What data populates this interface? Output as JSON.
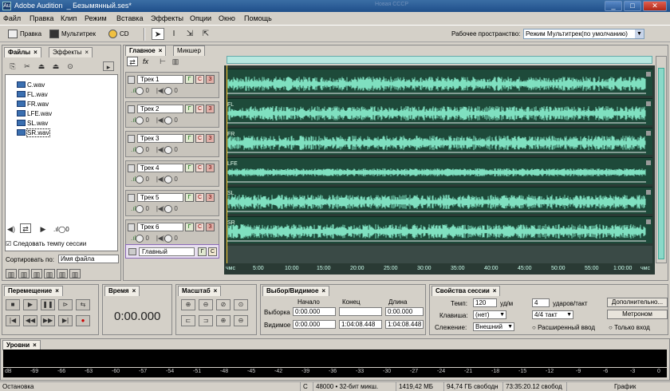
{
  "window": {
    "app_name": "Adobe Audition",
    "document_title": "Безымянный.ses*",
    "background_title": "Новая СССР",
    "minimize": "_",
    "maximize": "□",
    "close": "✕"
  },
  "menu": [
    "Файл",
    "Правка",
    "Клип",
    "Режим",
    "Вставка",
    "Эффекты",
    "Опции",
    "Окно",
    "Помощь"
  ],
  "toolbar": {
    "edit_label": "Правка",
    "multitrack_label": "Мультитрек",
    "cd_label": "CD",
    "workspace_label": "Рабочее пространство:",
    "workspace_value": "Режим Мультитрек(по умолчанию)"
  },
  "files_panel": {
    "tabs": [
      "Файлы",
      "Эффекты"
    ],
    "files": [
      "C.wav",
      "FL.wav",
      "FR.wav",
      "LFE.wav",
      "SL.wav",
      "SR.wav"
    ],
    "selected_file": "SR.wav",
    "follow_tempo_label": "Следовать темпу сессии",
    "follow_tempo_checked": true,
    "sort_label": "Сортировать по:",
    "sort_value": "Имя файла",
    "volume_value": "0"
  },
  "main_panel": {
    "tabs": [
      "Главное",
      "Микшер"
    ],
    "fx_label": "fx"
  },
  "tracks": [
    {
      "name": "Трек 1",
      "clip_label": "",
      "volume": "0",
      "pan": "0"
    },
    {
      "name": "Трек 2",
      "clip_label": "FL",
      "volume": "0",
      "pan": "0"
    },
    {
      "name": "Трек 3",
      "clip_label": "FR",
      "volume": "0",
      "pan": "0"
    },
    {
      "name": "Трек 4",
      "clip_label": "LFE",
      "volume": "0",
      "pan": "0"
    },
    {
      "name": "Трек 5",
      "clip_label": "SL",
      "volume": "0",
      "pan": "0"
    },
    {
      "name": "Трек 6",
      "clip_label": "SR",
      "volume": "0",
      "pan": "0"
    }
  ],
  "track_buttons": {
    "mute": "Г",
    "solo": "С",
    "record": "З"
  },
  "master": {
    "name": "Главный",
    "btn1": "Г",
    "btn2": "С"
  },
  "ruler": {
    "labels": [
      "чмс",
      "5:00",
      "10:00",
      "15:00",
      "20:00",
      "25:00",
      "30:00",
      "35:00",
      "40:00",
      "45:00",
      "50:00",
      "55:00",
      "1:00:00",
      "чмс"
    ]
  },
  "transport": {
    "title": "Перемещение"
  },
  "time_panel": {
    "title": "Время",
    "value": "0:00.000"
  },
  "zoom_panel": {
    "title": "Масштаб"
  },
  "selection_panel": {
    "title": "Выбор/Видимое",
    "col_start": "Начало",
    "col_end": "Конец",
    "col_length": "Длина",
    "row_selection": "Выборка",
    "row_view": "Видимое",
    "sel_start": "0:00.000",
    "sel_end": "",
    "sel_length": "0:00.000",
    "view_start": "0:00.000",
    "view_end": "1:04:08.448",
    "view_length": "1:04:08.448"
  },
  "session_panel": {
    "title": "Свойства сессии",
    "tempo_label": "Темп:",
    "tempo_value": "120",
    "tempo_unit": "уд/м",
    "beats_value": "4",
    "beats_label": "ударов/такт",
    "key_label": "Клавиша:",
    "key_value": "(нет)",
    "meter_value": "4/4 такт",
    "more_button": "Дополнительно...",
    "metronome_button": "Метроном",
    "follow_label": "Слежение:",
    "follow_value": "Внешний",
    "extended_input": "Расширенный ввод",
    "input_only": "Только вход"
  },
  "levels": {
    "title": "Уровни",
    "scale": [
      "dB",
      "-69",
      "-66",
      "-63",
      "-60",
      "-57",
      "-54",
      "-51",
      "-48",
      "-45",
      "-42",
      "-39",
      "-36",
      "-33",
      "-30",
      "-27",
      "-24",
      "-21",
      "-18",
      "-15",
      "-12",
      "-9",
      "-6",
      "-3",
      "0"
    ]
  },
  "status": {
    "state": "Остановка",
    "channel": "С",
    "format": "48000 • 32-бит микш.",
    "size": "1419,42 МБ",
    "free": "94,74 ГБ свободн",
    "free_time": "73:35:20.12 свобод",
    "view": "График"
  },
  "colors": {
    "wave": "#7fe0c0",
    "lane_bg": "#1e4a3a",
    "title_bar": "#2a5a98"
  }
}
